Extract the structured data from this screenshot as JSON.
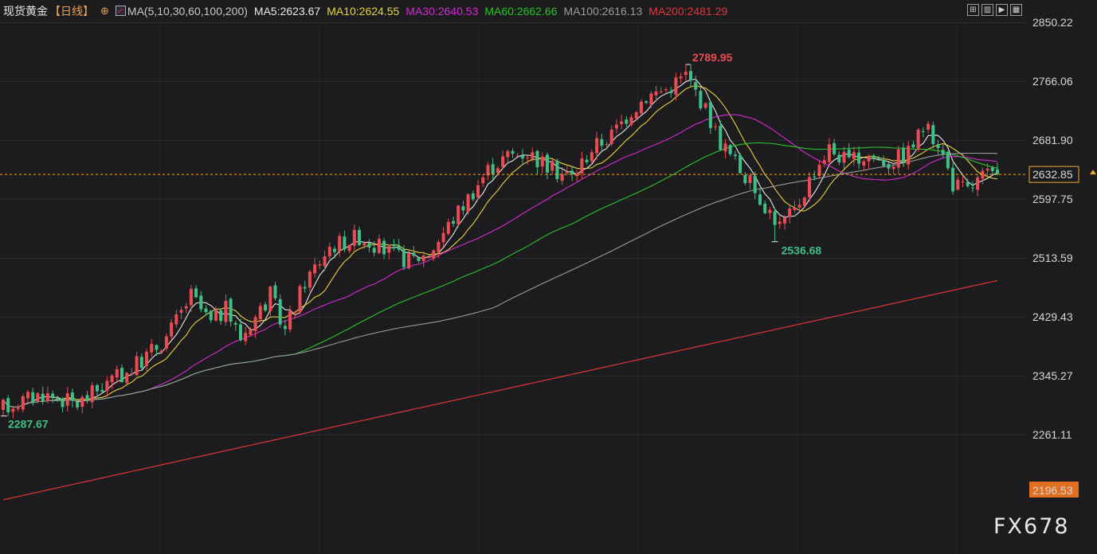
{
  "header": {
    "symbol": "现货黄金",
    "period": "【日线】",
    "add_icon": "plus-circle-icon",
    "ma_params": "MA(5,10,30,60,100,200)",
    "ma_values": [
      {
        "label": "MA5:2623.67",
        "color": "#e8e8e8"
      },
      {
        "label": "MA10:2624.55",
        "color": "#e8d23c"
      },
      {
        "label": "MA30:2640.53",
        "color": "#d42ad4"
      },
      {
        "label": "MA60:2662.66",
        "color": "#27c427"
      },
      {
        "label": "MA100:2616.13",
        "color": "#9a9a9a"
      },
      {
        "label": "MA200:2481.29",
        "color": "#e23636"
      }
    ]
  },
  "toolbar": [
    "layout-icon",
    "bar-chart-icon",
    "candle-icon",
    "kline-icon"
  ],
  "watermark": "FX678",
  "chart_data": {
    "type": "candlestick",
    "ylim": [
      2196.53,
      2850.22
    ],
    "y_ticks": [
      2850.22,
      2766.06,
      2681.9,
      2597.75,
      2513.59,
      2429.43,
      2345.27,
      2261.11,
      2196.53
    ],
    "last_price": 2632.85,
    "last_price_label": "2632.85",
    "low_price_label": "2196.53",
    "high_marker": {
      "label": "2789.95",
      "value": 2789.95
    },
    "low_marker": {
      "label": "2536.68",
      "value": 2536.68
    },
    "start_low_marker": {
      "label": "2287.67",
      "value": 2287.67
    },
    "colors": {
      "up": "#ec4b53",
      "down": "#3fbf86",
      "last": "#f0a830"
    },
    "ohlc": [],
    "ma_lines": {}
  }
}
